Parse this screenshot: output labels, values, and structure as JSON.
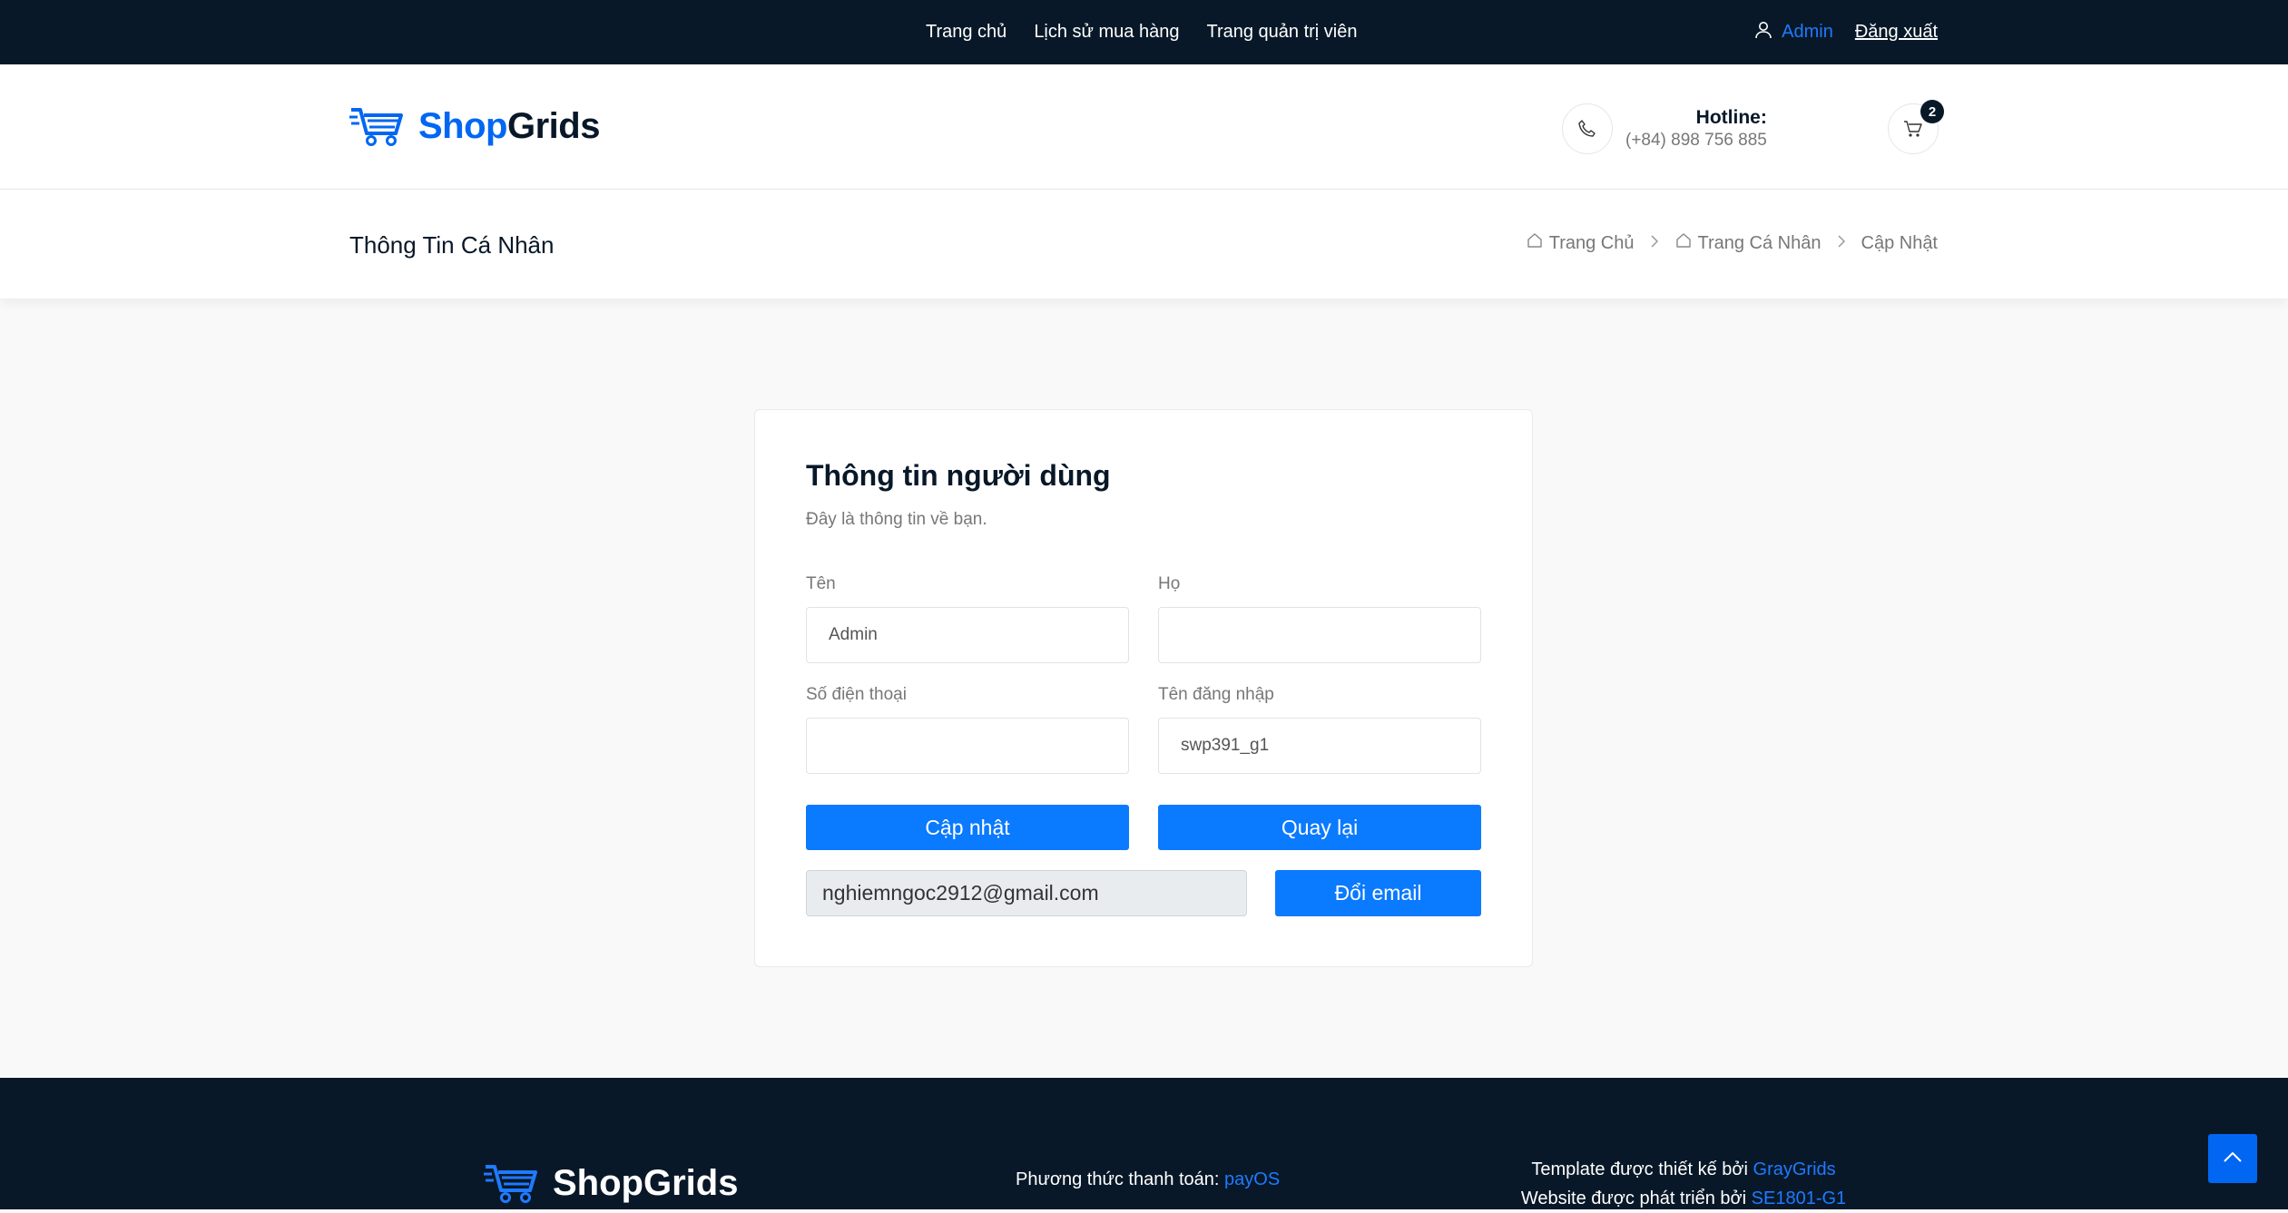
{
  "topbar": {
    "nav": [
      "Trang chủ",
      "Lịch sử mua hàng",
      "Trang quản trị viên"
    ],
    "user": "Admin",
    "logout": "Đăng xuất"
  },
  "header": {
    "logo_shop": "Shop",
    "logo_grids": "Grids",
    "hotline_label": "Hotline:",
    "hotline_number": "(+84) 898 756 885",
    "cart_count": "2"
  },
  "breadcrumb": {
    "title": "Thông Tin Cá Nhân",
    "items": [
      "Trang Chủ",
      "Trang Cá Nhân",
      "Cập Nhật"
    ]
  },
  "form": {
    "title": "Thông tin người dùng",
    "subtitle": "Đây là thông tin về bạn.",
    "first_name_label": "Tên",
    "first_name_value": "Admin",
    "last_name_label": "Họ",
    "last_name_value": "",
    "phone_label": "Số điện thoại",
    "phone_value": "",
    "username_label": "Tên đăng nhập",
    "username_value": "swp391_g1",
    "update_button": "Cập nhật",
    "back_button": "Quay lại",
    "email_value": "nghiemngoc2912@gmail.com",
    "change_email_button": "Đổi email"
  },
  "footer": {
    "logo": "ShopGrids",
    "payment_label": "Phương thức thanh toán: ",
    "payment_link": "payOS",
    "template_label": "Template được thiết kế bởi ",
    "template_link": "GrayGrids",
    "dev_label": "Website được phát triển bởi ",
    "dev_link": "SE1801-G1"
  },
  "colors": {
    "dark": "#081828",
    "accent": "#0167f3",
    "button": "#0a7aff"
  },
  "icons": [
    "user-icon",
    "phone-icon",
    "cart-icon",
    "home-icon",
    "chevron-right-icon",
    "chevron-up-icon",
    "logo-cart-icon"
  ]
}
